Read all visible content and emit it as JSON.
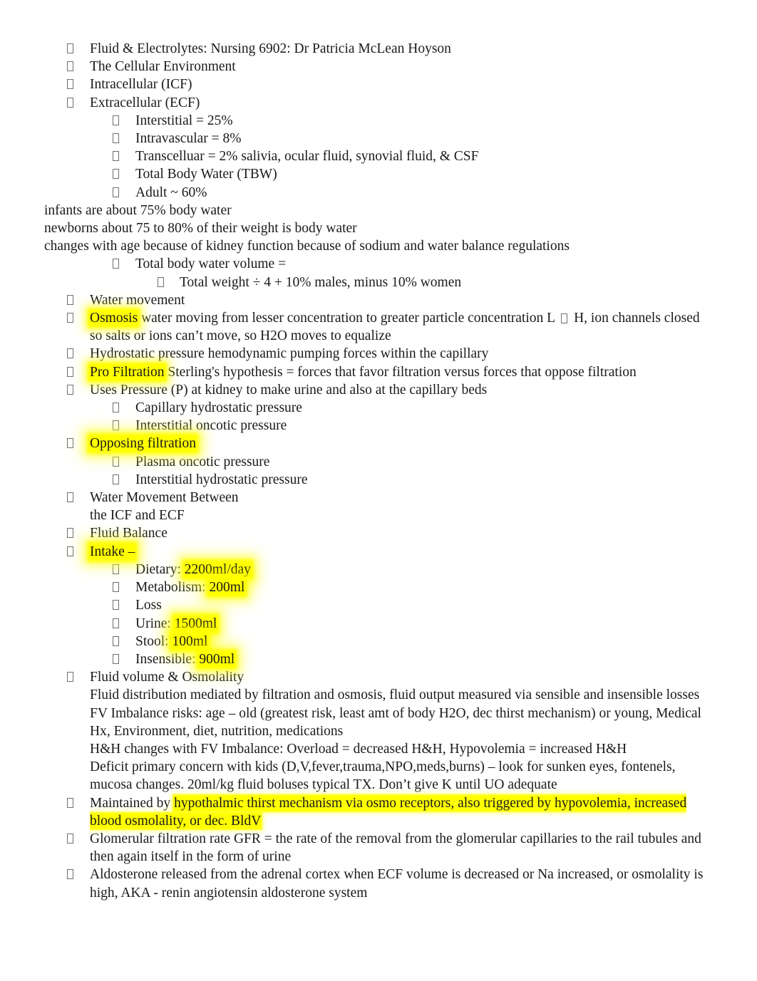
{
  "document": {
    "title": "Fluid & Electrolytes: Nursing 6902: Dr Patricia McLean Hoyson",
    "bullet_glyph": "missing-glyph-box",
    "highlight_color": "#ffff00",
    "text_color": "#1a1a1a",
    "page_background": "#ffffff"
  },
  "outline": {
    "l1_title": "Fluid & Electrolytes: Nursing 6902: Dr Patricia McLean Hoyson",
    "l1_cellular_environment": "The Cellular Environment",
    "l1_intracellular": "Intracellular (ICF)",
    "l1_extracellular": "Extracellular (ECF)",
    "l2_interstitial": "Interstitial = 25%",
    "l2_intravascular": "Intravascular = 8%",
    "l2_transcelluar": "Transcelluar = 2% salivia, ocular fluid, synovial fluid, & CSF",
    "l2_tbw": "Total Body Water (TBW)",
    "l2_adult": "Adult ~ 60%",
    "flush_infants": "infants are about 75% body water",
    "flush_newborns": "newborns about 75 to 80% of their weight is body water",
    "flush_changes": "changes with age because of kidney function because of sodium and water balance regulations",
    "l2_tbw_volume": "Total body water volume =",
    "l3_total_weight": "Total weight ÷ 4 + 10% males, minus 10% women",
    "l1_water_movement": "Water movement",
    "osmosis_highlight": "Osmosis",
    "osmosis_rest_a": " water moving from lesser concentration to greater particle concentration L ",
    "osmosis_arrow": "arrow-glyph",
    "osmosis_rest_b": " H, ion channels closed so salts or ions can’t move, so H2O moves to equalize",
    "l1_hydrostatic": "Hydrostatic pressure hemodynamic pumping forces within the capillary",
    "pro_filtration_highlight": "Pro Filtration",
    "pro_filtration_rest": " Sterling's hypothesis = forces that favor filtration versus forces that oppose filtration",
    "l1_uses_pressure": "Uses Pressure (P) at kidney to make urine and also at the capillary beds",
    "l2_capillary_hydrostatic": "Capillary hydrostatic pressure",
    "l2_interstitial_oncotic": "Interstitial oncotic pressure",
    "opposing_filtration_highlight": "Opposing filtration",
    "l2_plasma_oncotic": "Plasma oncotic pressure",
    "l2_interstitial_hydrostatic": "Interstitial hydrostatic pressure",
    "l1_water_movement_between": "Water Movement Between",
    "l1_the_icf_and_ecf": "the ICF and ECF",
    "l1_fluid_balance": "Fluid Balance",
    "intake_highlight": "Intake –",
    "l2_dietary_label": "Dietary: ",
    "l2_dietary_value": "2200ml/day",
    "l2_metabolism_label": "Metabolism:  ",
    "l2_metabolism_value": "200ml",
    "l2_loss": "Loss",
    "l2_urine_label": "Urine: ",
    "l2_urine_value": "1500ml",
    "l2_stool_label": "Stool: ",
    "l2_stool_value": "100ml",
    "l2_insensible_label": "Insensible: ",
    "l2_insensible_value": "900ml",
    "l1_fluid_volume_osmolality": "Fluid volume & Osmolality",
    "p_fluid_distribution": "Fluid distribution mediated by filtration and osmosis, fluid output measured via sensible and insensible losses",
    "p_fv_imbalance": "FV Imbalance risks: age – old (greatest risk, least amt of body H2O, dec thirst mechanism) or young, Medical Hx, Environment, diet, nutrition, medications",
    "p_hh_changes": "H&H changes with FV Imbalance: Overload = decreased H&H, Hypovolemia = increased H&H",
    "p_deficit": "Deficit primary concern with kids (D,V,fever,trauma,NPO,meds,burns) – look for sunken eyes, fontenels, mucosa changes. 20ml/kg fluid boluses typical TX. Don’t give K until UO adequate",
    "maintained_prefix": "Maintained by ",
    "maintained_highlight": "hypothalmic thirst mechanism via osmo receptors, also triggered by hypovolemia, increased blood osmolality, or dec. BldV",
    "l1_gfr": "Glomerular filtration rate GFR = the rate of the removal from the glomerular capillaries to the rail tubules and then again itself in the form of urine",
    "l1_aldosterone": "Aldosterone released from the adrenal cortex when ECF volume is decreased or Na increased, or osmolality is high, AKA - renin angiotensin aldosterone system"
  }
}
